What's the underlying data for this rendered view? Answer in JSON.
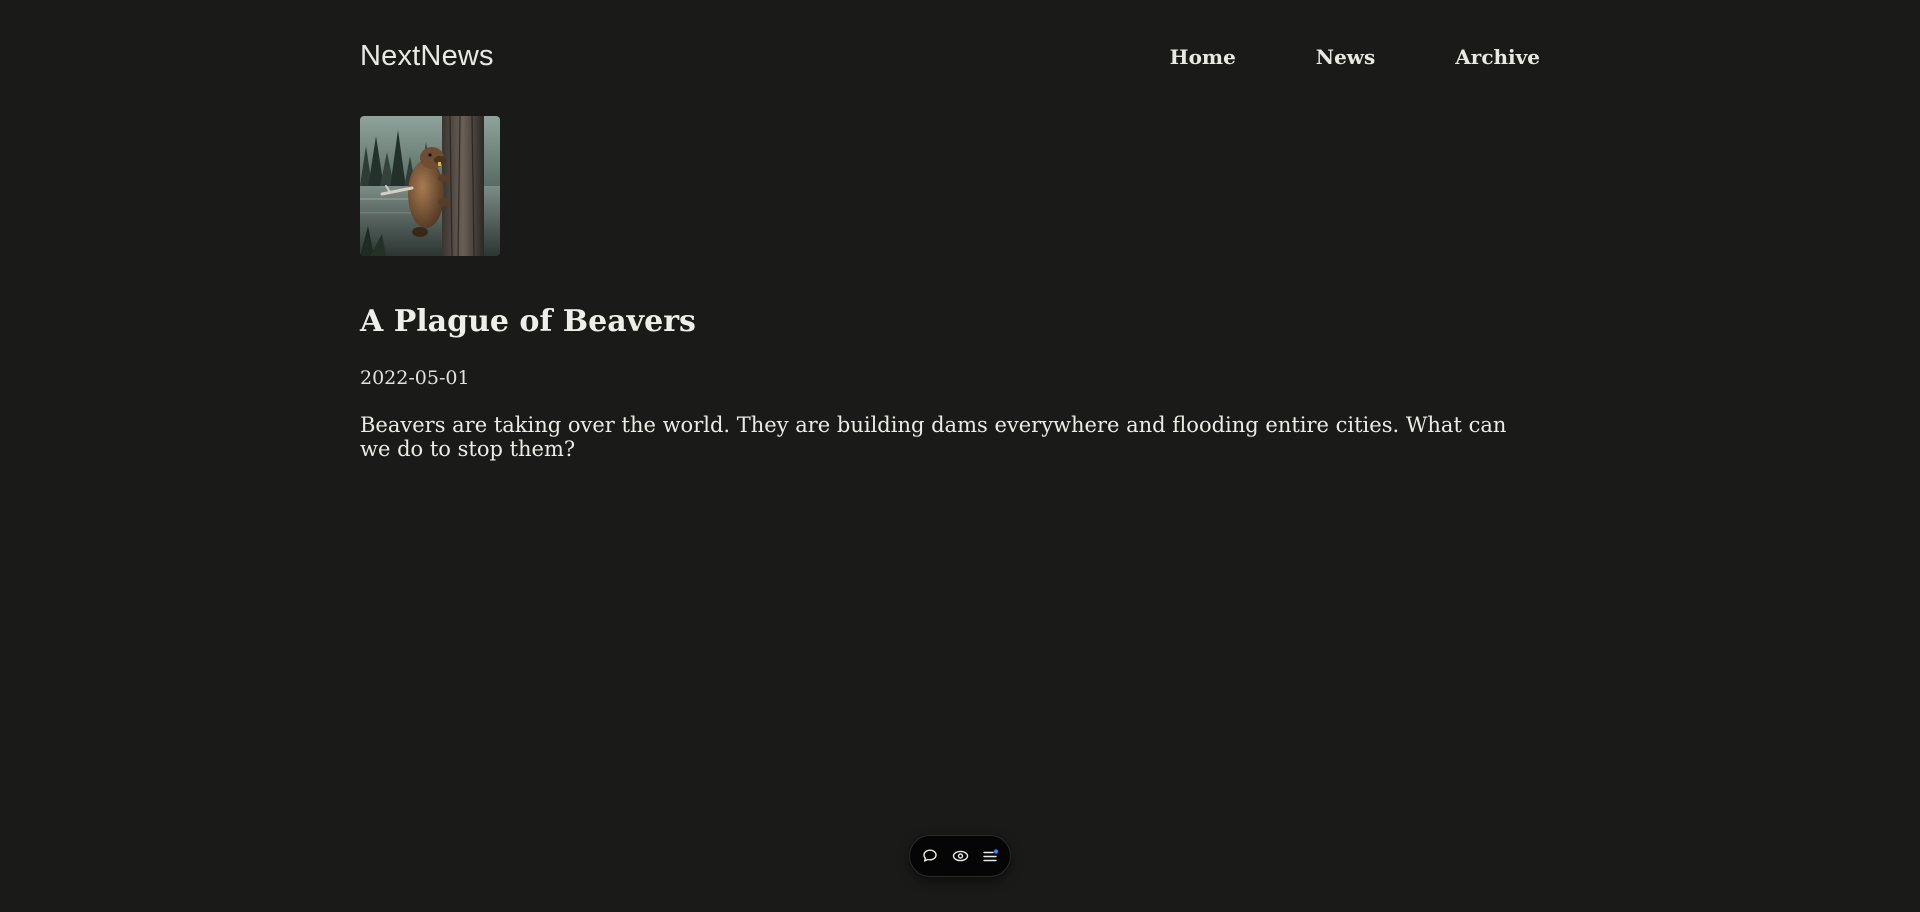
{
  "site": {
    "logo": "NextNews"
  },
  "nav": {
    "items": [
      {
        "label": "Home"
      },
      {
        "label": "News"
      },
      {
        "label": "Archive"
      }
    ]
  },
  "article": {
    "image_alt": "Beaver climbing a tree beside a forest lake",
    "title": "A Plague of Beavers",
    "date": "2022-05-01",
    "excerpt": "Beavers are taking over the world. They are building dams everywhere and flooding entire cities. What can we do to stop them?"
  },
  "toolbar": {
    "icons": [
      "comment-icon",
      "eye-icon",
      "menu-icon"
    ],
    "accent": "#3b82f6"
  }
}
